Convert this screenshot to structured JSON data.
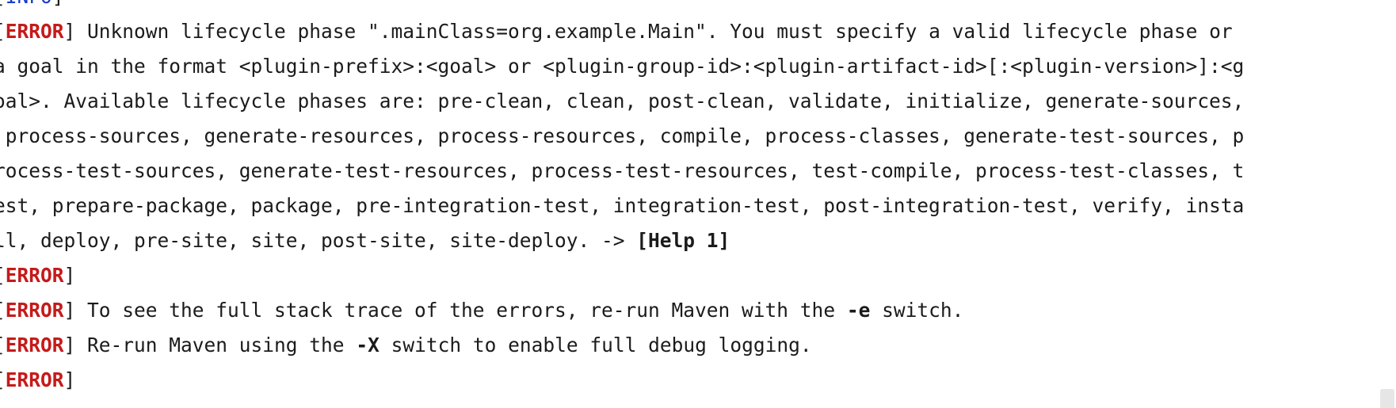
{
  "console": {
    "lines": [
      {
        "tag": "INFO",
        "text": " ------------------------------------------------------------------------"
      },
      {
        "tag": "ERROR",
        "text": " Unknown lifecycle phase \".mainClass=org.example.Main\". You must specify a valid lifecycle phase or"
      },
      {
        "tag": "",
        "text": "a goal in the format <plugin-prefix>:<goal> or <plugin-group-id>:<plugin-artifact-id>[:<plugin-version>]:<g"
      },
      {
        "tag": "",
        "text": "oal>. Available lifecycle phases are: pre-clean, clean, post-clean, validate, initialize, generate-sources,"
      },
      {
        "tag": "",
        "text": " process-sources, generate-resources, process-resources, compile, process-classes, generate-test-sources, p"
      },
      {
        "tag": "",
        "text": "rocess-test-sources, generate-test-resources, process-test-resources, test-compile, process-test-classes, t"
      },
      {
        "tag": "",
        "text": "est, prepare-package, package, pre-integration-test, integration-test, post-integration-test, verify, insta"
      },
      {
        "tag": "",
        "text": "ll, deploy, pre-site, site, post-site, site-deploy. -> ",
        "bold_suffix": "[Help 1]"
      },
      {
        "tag": "ERROR",
        "text": ""
      },
      {
        "tag": "ERROR",
        "text": " To see the full stack trace of the errors, re-run Maven with the ",
        "bold_mid": "-e",
        "after": " switch."
      },
      {
        "tag": "ERROR",
        "text": " Re-run Maven using the ",
        "bold_mid": "-X",
        "after": " switch to enable full debug logging."
      },
      {
        "tag": "ERROR",
        "text": ""
      }
    ]
  },
  "colors": {
    "info_tag": "#1a3dc8",
    "error_tag": "#c61a1a",
    "text": "#1b1b1b",
    "background": "#ffffff"
  }
}
